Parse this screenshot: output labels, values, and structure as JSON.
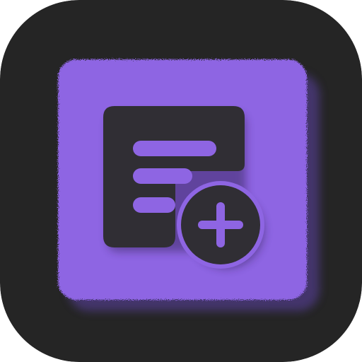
{
  "icon": {
    "name": "add-note-app-icon",
    "glyph": "document-plus-icon",
    "colors": {
      "background": "#252525",
      "tile": "#8e65e3",
      "tile_shadow": "#4a3778",
      "glyph": "#302e34",
      "line_cutout": "#8e65e3"
    }
  }
}
